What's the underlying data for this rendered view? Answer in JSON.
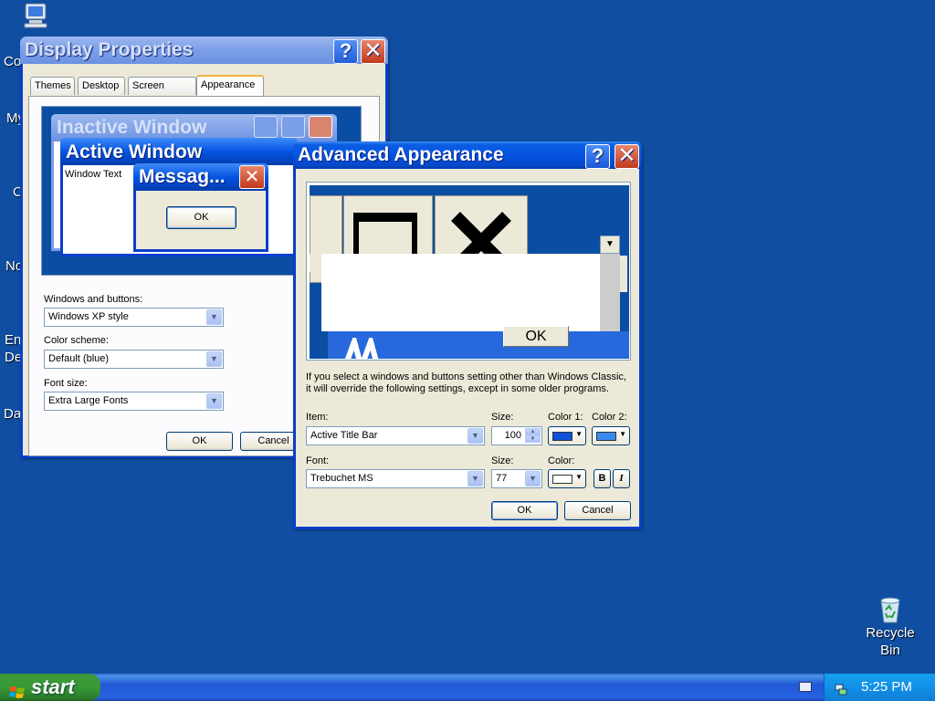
{
  "desktop": {
    "icon_labels_partial": [
      "Co",
      "My",
      "C",
      "No",
      "En",
      "De",
      "Da"
    ],
    "recycle_bin_label_line1": "Recycle",
    "recycle_bin_label_line2": "Bin"
  },
  "display_properties": {
    "title": "Display Properties",
    "tabs": [
      "Themes",
      "Desktop",
      "Screen Saver",
      "Appearance"
    ],
    "active_tab": "Appearance",
    "preview": {
      "inactive_title": "Inactive Window",
      "active_title": "Active Window",
      "window_text": "Window Text",
      "message_title": "Messag...",
      "message_ok": "OK"
    },
    "windows_buttons_label": "Windows and buttons:",
    "windows_buttons_value": "Windows XP style",
    "color_scheme_label": "Color scheme:",
    "color_scheme_value": "Default (blue)",
    "font_size_label": "Font size:",
    "font_size_value": "Extra Large Fonts",
    "ok_label": "OK",
    "cancel_label": "Cancel"
  },
  "advanced_appearance": {
    "title": "Advanced Appearance",
    "preview_ok": "OK",
    "info_line1": "If you select a windows and buttons setting other than Windows Classic,",
    "info_line2": "it will override the following settings, except in some older programs.",
    "item_label": "Item:",
    "item_value": "Active Title Bar",
    "item_size_label": "Size:",
    "item_size_value": "100",
    "color1_label": "Color 1:",
    "color2_label": "Color 2:",
    "color1": "#1150d8",
    "color2": "#3a8bf0",
    "font_label": "Font:",
    "font_value": "Trebuchet MS",
    "font_size_label": "Size:",
    "font_size_value": "77",
    "font_color_label": "Color:",
    "font_color": "#ffffff",
    "bold_label": "B",
    "italic_label": "I",
    "ok_label": "OK",
    "cancel_label": "Cancel"
  },
  "taskbar": {
    "start_label": "start",
    "clock": "5:25 PM"
  }
}
